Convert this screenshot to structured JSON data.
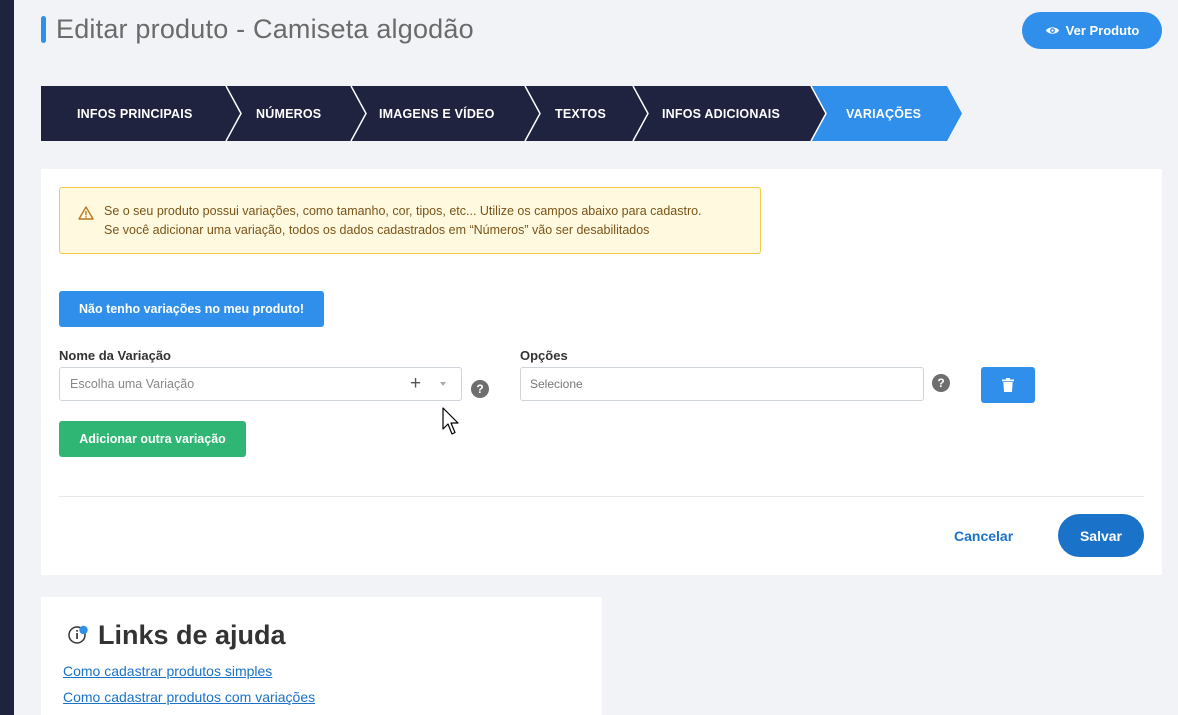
{
  "header": {
    "title": "Editar produto - Camiseta algodão",
    "view_product_label": "Ver Produto"
  },
  "steps": [
    {
      "label": "INFOS PRINCIPAIS",
      "active": false
    },
    {
      "label": "NÚMEROS",
      "active": false
    },
    {
      "label": "IMAGENS E VÍDEO",
      "active": false
    },
    {
      "label": "TEXTOS",
      "active": false
    },
    {
      "label": "INFOS ADICIONAIS",
      "active": false
    },
    {
      "label": "VARIAÇÕES",
      "active": true
    }
  ],
  "alert": {
    "line1": "Se o seu produto possui variações, como tamanho, cor, tipos, etc... Utilize os campos abaixo para cadastro.",
    "line2": "Se você adicionar uma variação, todos os dados cadastrados em “Números” vão ser desabilitados"
  },
  "no_variations_label": "Não tenho variações no meu produto!",
  "variation": {
    "name_label": "Nome da Variação",
    "name_placeholder": "Escolha uma Variação",
    "options_label": "Opções",
    "options_placeholder": "Selecione",
    "help_glyph": "?"
  },
  "add_variation_label": "Adicionar outra variação",
  "actions": {
    "cancel_label": "Cancelar",
    "save_label": "Salvar"
  },
  "help": {
    "title": "Links de ajuda",
    "links": [
      "Como cadastrar produtos simples",
      "Como cadastrar produtos com variações"
    ]
  },
  "colors": {
    "primary": "#2f8fea",
    "dark_blue": "#1a73c9",
    "nav_dark": "#1f2340",
    "success": "#2fb574",
    "alert_bg": "#fff9e0",
    "alert_border": "#f2c94c"
  }
}
